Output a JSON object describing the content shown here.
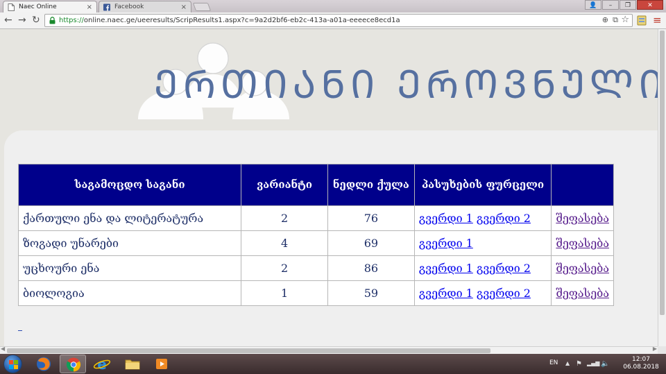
{
  "browser": {
    "tabs": [
      {
        "title": "Naec Online",
        "active": true
      },
      {
        "title": "Facebook",
        "active": false
      }
    ],
    "tab_close_glyph": "×",
    "window_controls": {
      "user": "👤",
      "minimize": "–",
      "restore": "❐",
      "close": "✕"
    },
    "nav": {
      "back": "←",
      "forward": "→",
      "reload": "↻"
    },
    "url": {
      "scheme": "https://",
      "rest": "online.naec.ge/ueeresults/ScripResults1.aspx?c=9a2d2bf6-eb2c-413a-a01a-eeeece8ecd1a"
    },
    "omnibox_icons": {
      "zoom": "⊕",
      "translate": "⧉",
      "bookmark": "☆"
    },
    "menu": "≡",
    "colors": {
      "secure": "#1a8a2e",
      "close": "#c9463d"
    }
  },
  "page": {
    "banner_title": "ᲔᲠᲗᲘᲐᲜᲘ ᲔᲠᲝᲕᲜᲣᲚᲘ ᲒᲐᲛᲝᲪᲓ",
    "table": {
      "headers": [
        "საგამოცდო საგანი",
        "ვარიანტი",
        "ნედლი ქულა",
        "პასუხების ფურცელი",
        ""
      ],
      "rows": [
        {
          "subject": "ქართული ენა და ლიტერატურა",
          "variant": "2",
          "score": "76",
          "page1": "გვერდი 1",
          "page2": "გვერდი 2",
          "appeal": "შეფასება"
        },
        {
          "subject": "ზოგადი უნარები",
          "variant": "4",
          "score": "69",
          "page1": "გვერდი 1",
          "page2": "",
          "appeal": "შეფასება"
        },
        {
          "subject": "უცხოური ენა",
          "variant": "2",
          "score": "86",
          "page1": "გვერდი 1",
          "page2": "გვერდი 2",
          "appeal": "შეფასება"
        },
        {
          "subject": "ბიოლოგია",
          "variant": "1",
          "score": "59",
          "page1": "გვერდი 1",
          "page2": "გვერდი 2",
          "appeal": "შეფასება"
        }
      ]
    },
    "colors": {
      "header_bg": "#00008b",
      "link": "#0000ee",
      "visited_link": "#551a8b",
      "banner": "#5670a0"
    }
  },
  "taskbar": {
    "apps": [
      "firefox",
      "chrome",
      "internet-explorer",
      "file-explorer",
      "media-player"
    ],
    "language": "EN",
    "tray": {
      "up_arrow": "▲",
      "flag": "⚑",
      "network": "▂▄▆",
      "volume": "🔈"
    },
    "time": "12:07",
    "date": "06.08.2018"
  }
}
